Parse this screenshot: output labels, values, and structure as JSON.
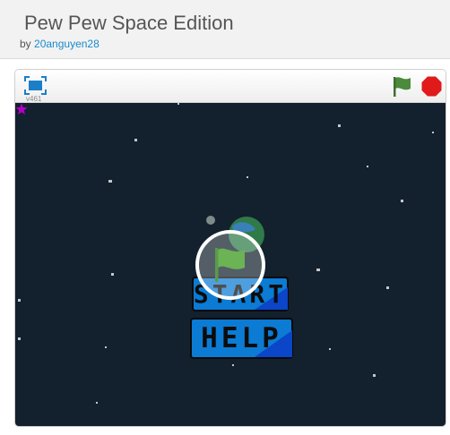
{
  "project": {
    "title": "Pew Pew Space Edition",
    "by_label": "by",
    "author": "20anguyen28"
  },
  "player": {
    "version": "v461",
    "icons": {
      "fullscreen": "fullscreen-icon",
      "green_flag": "green-flag-icon",
      "stop": "stop-sign-icon",
      "play": "play-flag-icon"
    }
  },
  "stage": {
    "start_label": "START",
    "help_label": "HELP"
  },
  "colors": {
    "stage_bg": "#13202d",
    "link": "#1a8acd",
    "flag_green": "#4b8b3b",
    "stop_red": "#e01a1a",
    "button_blue": "#0b7bd4"
  }
}
